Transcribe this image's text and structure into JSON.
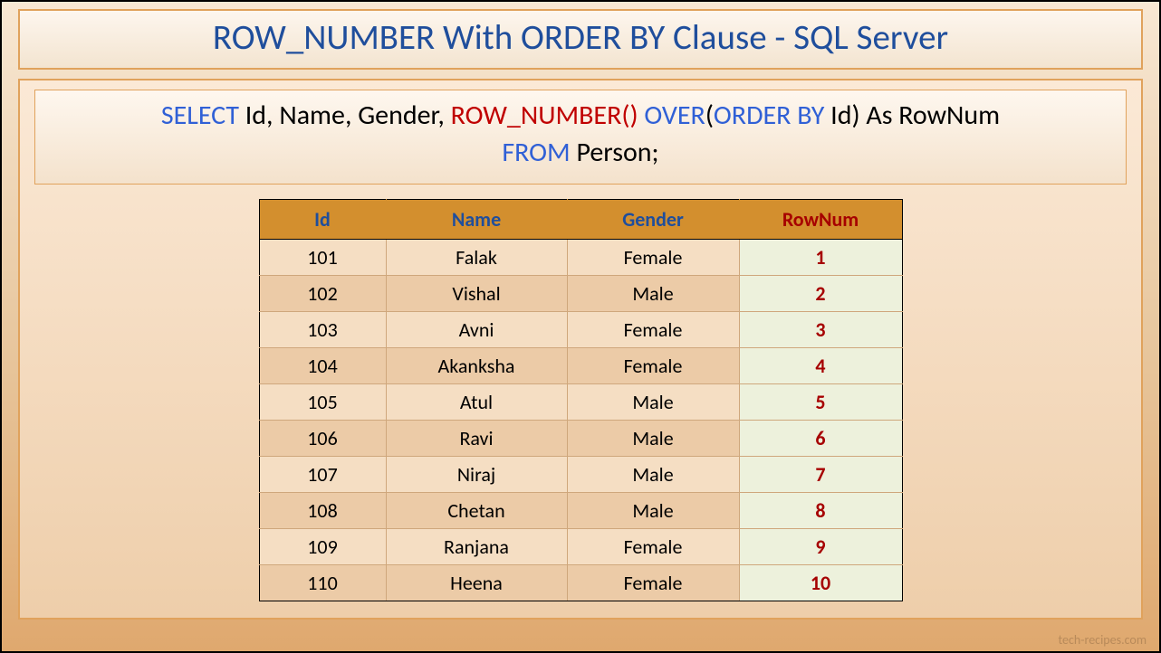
{
  "title": "ROW_NUMBER With ORDER BY Clause - SQL Server",
  "query": {
    "select": "SELECT",
    "cols": " Id, Name, Gender, ",
    "rownum": "ROW_NUMBER()",
    "over": " OVER",
    "openp": "(",
    "orderby": "ORDER BY",
    "orderbycol": " Id",
    "closep": ")",
    "as": " As RowNum",
    "from": "FROM",
    "table": " Person;"
  },
  "headers": {
    "id": "Id",
    "name": "Name",
    "gender": "Gender",
    "rownum": "RowNum"
  },
  "rows": [
    {
      "id": "101",
      "name": "Falak",
      "gender": "Female",
      "rownum": "1"
    },
    {
      "id": "102",
      "name": "Vishal",
      "gender": "Male",
      "rownum": "2"
    },
    {
      "id": "103",
      "name": "Avni",
      "gender": "Female",
      "rownum": "3"
    },
    {
      "id": "104",
      "name": "Akanksha",
      "gender": "Female",
      "rownum": "4"
    },
    {
      "id": "105",
      "name": "Atul",
      "gender": "Male",
      "rownum": "5"
    },
    {
      "id": "106",
      "name": "Ravi",
      "gender": "Male",
      "rownum": "6"
    },
    {
      "id": "107",
      "name": "Niraj",
      "gender": "Male",
      "rownum": "7"
    },
    {
      "id": "108",
      "name": "Chetan",
      "gender": "Male",
      "rownum": "8"
    },
    {
      "id": "109",
      "name": "Ranjana",
      "gender": "Female",
      "rownum": "9"
    },
    {
      "id": "110",
      "name": "Heena",
      "gender": "Female",
      "rownum": "10"
    }
  ],
  "watermark": "tech-recipes.com"
}
